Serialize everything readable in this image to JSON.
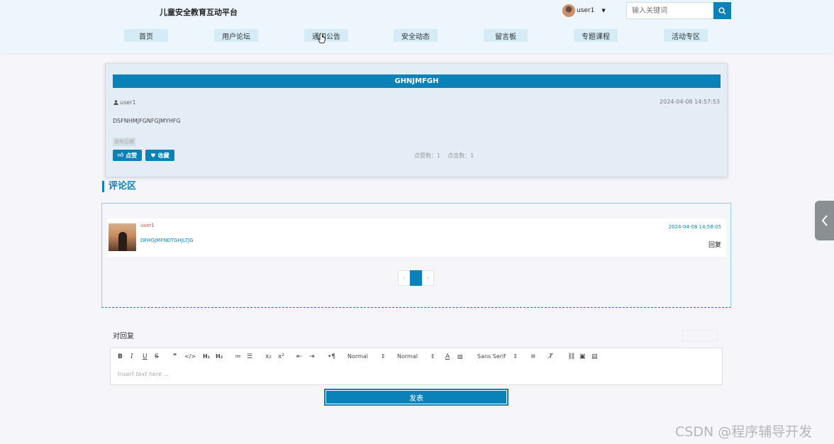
{
  "header": {
    "site_title": "儿童安全教育互动平台",
    "username": "user1",
    "search_placeholder": "输入关键词"
  },
  "nav": {
    "items": [
      {
        "label": "首页"
      },
      {
        "label": "用户论坛"
      },
      {
        "label": "通知公告"
      },
      {
        "label": "安全动态"
      },
      {
        "label": "留言板"
      },
      {
        "label": "专题课程"
      },
      {
        "label": "活动专区"
      }
    ]
  },
  "post": {
    "title": "GHNJMFGH",
    "author": "user1",
    "date": "2024-04-08 14:57:53",
    "content": "DSFNHMJFGNFGJMYHFG",
    "tag": "发布日期",
    "like_label": "点赞",
    "favorite_label": "收藏",
    "like_count_label": "点赞数：",
    "like_count": "1",
    "view_count_label": "点击数：",
    "view_count": "1"
  },
  "comments": {
    "heading": "评论区",
    "items": [
      {
        "user": "user1",
        "text": "DFHGJMFNDTGHJLTJG",
        "date": "2024-04-08 14:58:05",
        "reply_label": "回复"
      }
    ],
    "pager": {
      "prev": "‹",
      "current": "1",
      "next": "›"
    }
  },
  "reply": {
    "label": "对回复",
    "toolbar": {
      "header_select": "Normal",
      "size_select": "Normal",
      "font_select": "Sans Serif"
    },
    "placeholder": "Insert text here ...",
    "submit_label": "发表"
  },
  "watermark": "CSDN @程序辅导开发",
  "colors": {
    "accent": "#0a82b7",
    "header_bg": "#eef6fd",
    "card_bg": "#e4edf6"
  }
}
